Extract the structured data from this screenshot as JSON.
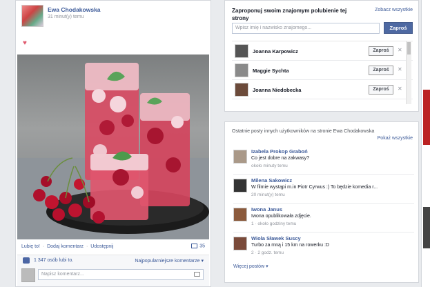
{
  "post": {
    "author": "Ewa Chodakowska",
    "time": "31 minut(y) temu",
    "actions": [
      "Lubię to!",
      "Dodaj komentarz",
      "Udostępnij"
    ],
    "comment_count": "35",
    "likes": "1 347 osób lubi to.",
    "sort": "Najpopularniejsze komentarze ▾",
    "comment_placeholder": "Napisz komentarz..."
  },
  "suggest": {
    "title": "Zaproponuj swoim znajomym polubienie tej strony",
    "see_all": "Zobacz wszystkie",
    "search_placeholder": "Wpisz imię i nazwisko znajomego...",
    "invite_label": "Zaproś",
    "friends": [
      {
        "name": "Joanna Karpowicz",
        "button": "Zaproś"
      },
      {
        "name": "Maggie Sychta",
        "button": "Zaproś"
      },
      {
        "name": "Joanna Niedobecka",
        "button": "Zaproś"
      }
    ]
  },
  "recent": {
    "title": "Ostatnie posty innych użytkowników na stronie Ewa Chodakowska",
    "see_all": "Pokaż wszystkie",
    "items": [
      {
        "author": "Izabela Prokop Graboń",
        "text": "Co jest dobre na zakwasy?",
        "meta": "około minuty temu"
      },
      {
        "author": "Milena Sakowicz",
        "text": "W filmie wystąpi m.in Piotr Cyrwus :) To będzie komedia r...",
        "meta": "20 minut(y) temu"
      },
      {
        "author": "Iwona Janus",
        "text": "Iwona opublikowała zdjęcie.",
        "meta": "1 · około godziny temu"
      },
      {
        "author": "Wiola Sławek Suscy",
        "text": "Turbo za mną i 15 km na rowerku :D",
        "meta": "2 · 2 godz. temu"
      }
    ],
    "more": "Więcej postów ▾"
  },
  "colors": {
    "brand": "#3b5998",
    "button": "#4e69a2"
  }
}
